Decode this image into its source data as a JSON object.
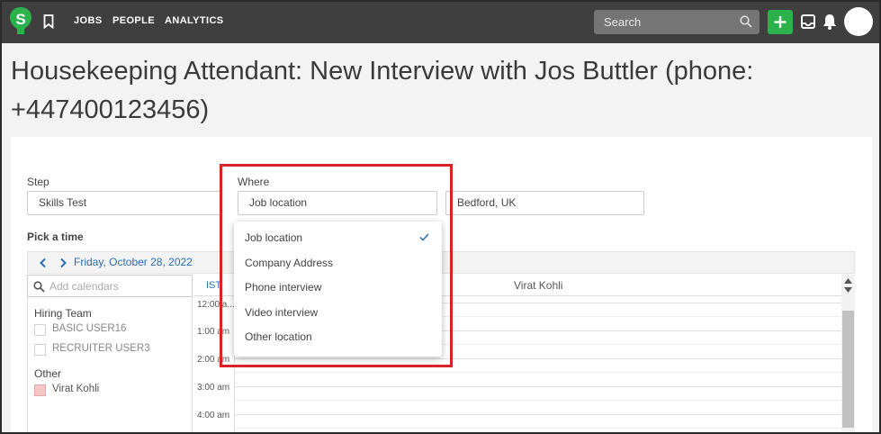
{
  "app": {
    "logo_letter": "S",
    "brand_color": "#2bb24c",
    "topbar_color": "#3f3f3f"
  },
  "nav": {
    "items": [
      "JOBS",
      "PEOPLE",
      "ANALYTICS"
    ]
  },
  "search": {
    "placeholder": "Search"
  },
  "icons": {
    "bookmark": "bookmark-icon",
    "search": "search-icon",
    "add": "plus-icon",
    "inbox": "inbox-icon",
    "notifications": "bell-icon",
    "avatar": "avatar"
  },
  "page": {
    "title": "Housekeeping Attendant: New Interview with Jos Buttler (phone: +447400123456)"
  },
  "form": {
    "step_label": "Step",
    "step_value": "Skills Test",
    "where_label": "Where",
    "where_value": "Job location",
    "location_value": "Bedford, UK",
    "pick_time_label": "Pick a time"
  },
  "where_dropdown": {
    "options": [
      "Job location",
      "Company Address",
      "Phone interview",
      "Video interview",
      "Other location"
    ],
    "selected": "Job location",
    "highlight_color": "#d8232a"
  },
  "calendar": {
    "date": "Friday, October 28, 2022",
    "add_calendars_placeholder": "Add calendars",
    "hiring_team_label": "Hiring Team",
    "hiring_team": [
      "BASIC USER16",
      "RECRUITER USER3"
    ],
    "other_label": "Other",
    "other": [
      "Virat Kohli"
    ],
    "other_color": "#f4c6c6",
    "timezone": "IST",
    "column": "Virat Kohli",
    "times": [
      "12:00 a...",
      "1:00 am",
      "2:00 am",
      "3:00 am",
      "4:00 am"
    ]
  }
}
